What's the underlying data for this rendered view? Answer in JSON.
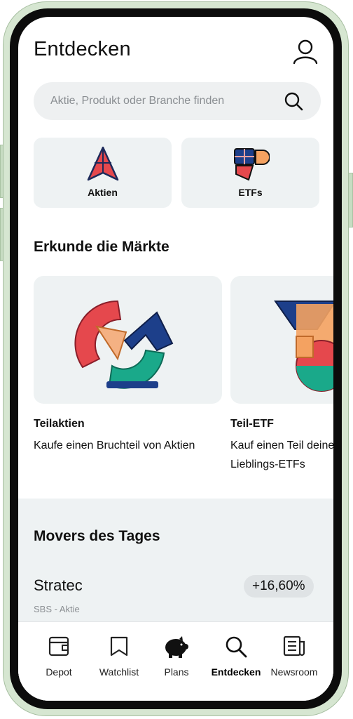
{
  "header": {
    "title": "Entdecken",
    "profile_icon": "person-icon"
  },
  "search": {
    "placeholder": "Aktie, Produkt oder Branche finden",
    "icon": "search-icon"
  },
  "categories": [
    {
      "label": "Aktien",
      "icon": "aktien-icon"
    },
    {
      "label": "ETFs",
      "icon": "etfs-icon"
    }
  ],
  "markets": {
    "heading": "Erkunde die Märkte",
    "cards": [
      {
        "title": "Teilaktien",
        "description": "Kaufe einen Bruchteil von Aktien"
      },
      {
        "title": "Teil-ETF",
        "description": "Kauf einen Teil deiner Lieblings-ETFs"
      }
    ]
  },
  "movers": {
    "heading": "Movers des Tages",
    "items": [
      {
        "name": "Stratec",
        "subtitle": "SBS - Aktie",
        "change": "+16,60%"
      }
    ]
  },
  "tabbar": {
    "items": [
      {
        "label": "Depot",
        "icon": "wallet-icon"
      },
      {
        "label": "Watchlist",
        "icon": "bookmark-icon"
      },
      {
        "label": "Plans",
        "icon": "piggy-bank-icon"
      },
      {
        "label": "Entdecken",
        "icon": "search-icon",
        "active": true
      },
      {
        "label": "Newsroom",
        "icon": "newspaper-icon"
      }
    ]
  },
  "colors": {
    "frame": "#d6e6d1",
    "card_bg": "#eef2f3",
    "red": "#e5484d",
    "blue": "#1d3f8a",
    "teal": "#1aa98a",
    "orange": "#f4a261"
  }
}
